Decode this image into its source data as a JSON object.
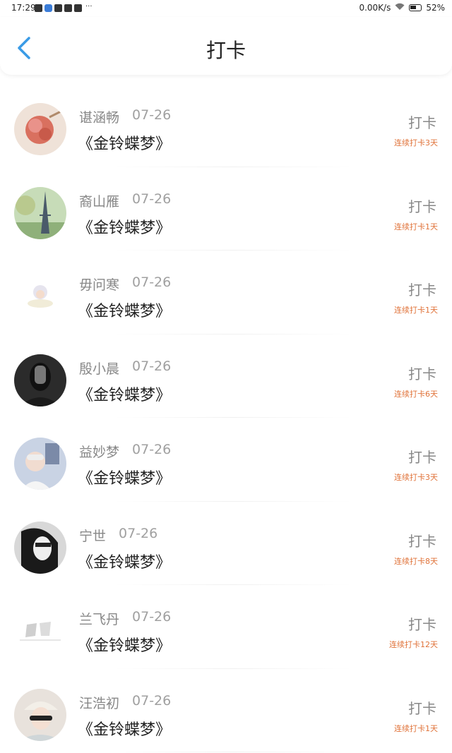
{
  "status_bar": {
    "time": "17:29",
    "network_speed": "0.00K/s",
    "battery": "52%",
    "more": "···"
  },
  "header": {
    "title": "打卡",
    "accent_color": "#3a9be6"
  },
  "checkins": [
    {
      "name": "谌涵畅",
      "date": "07-26",
      "book": "《金铃蝶梦》",
      "action": "打卡",
      "streak": "连续打卡3天",
      "avatar": "flower"
    },
    {
      "name": "裔山雁",
      "date": "07-26",
      "book": "《金铃蝶梦》",
      "action": "打卡",
      "streak": "连续打卡1天",
      "avatar": "eiffel"
    },
    {
      "name": "毋问寒",
      "date": "07-26",
      "book": "《金铃蝶梦》",
      "action": "打卡",
      "streak": "连续打卡1天",
      "avatar": "cartoon"
    },
    {
      "name": "殷小晨",
      "date": "07-26",
      "book": "《金铃蝶梦》",
      "action": "打卡",
      "streak": "连续打卡6天",
      "avatar": "masked"
    },
    {
      "name": "益妙梦",
      "date": "07-26",
      "book": "《金铃蝶梦》",
      "action": "打卡",
      "streak": "连续打卡3天",
      "avatar": "selfie"
    },
    {
      "name": "宁世",
      "date": "07-26",
      "book": "《金铃蝶梦》",
      "action": "打卡",
      "streak": "连续打卡8天",
      "avatar": "bw-portrait"
    },
    {
      "name": "兰飞丹",
      "date": "07-26",
      "book": "《金铃蝶梦》",
      "action": "打卡",
      "streak": "连续打卡12天",
      "avatar": "sketch"
    },
    {
      "name": "汪浩初",
      "date": "07-26",
      "book": "《金铃蝶梦》",
      "action": "打卡",
      "streak": "连续打卡1天",
      "avatar": "cap-boy"
    }
  ],
  "colors": {
    "streak": "#e0733a",
    "name": "#888888",
    "book": "#222222"
  }
}
